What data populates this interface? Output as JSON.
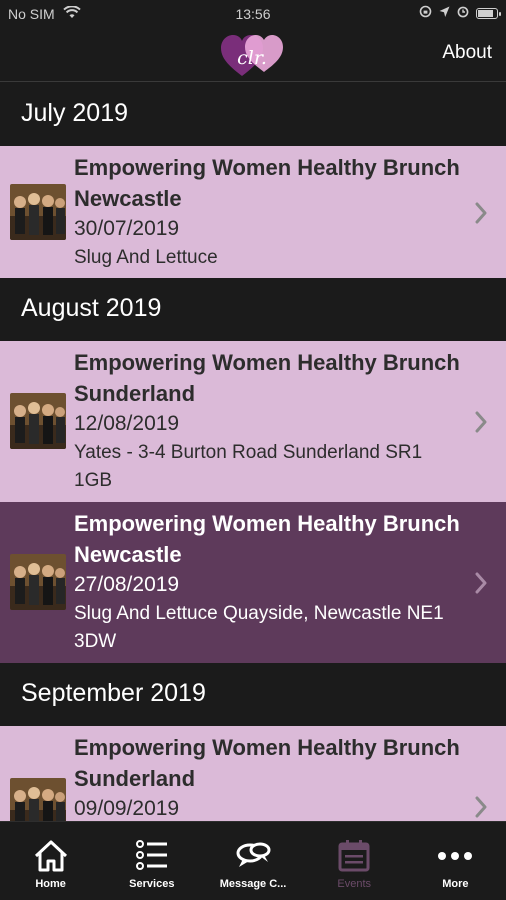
{
  "status": {
    "carrier": "No SIM",
    "time": "13:56"
  },
  "navbar": {
    "logo_text": "clr.",
    "about_label": "About"
  },
  "sections": [
    {
      "title": "July 2019",
      "events": [
        {
          "title_line1": "Empowering Women Healthy Brunch",
          "title_line2": "Newcastle",
          "date": "30/07/2019",
          "venue_line1": "Slug And Lettuce",
          "venue_line2": "",
          "selected": false
        }
      ]
    },
    {
      "title": "August 2019",
      "events": [
        {
          "title_line1": "Empowering Women Healthy Brunch",
          "title_line2": "Sunderland",
          "date": "12/08/2019",
          "venue_line1": "Yates - 3-4 Burton Road Sunderland SR1",
          "venue_line2": "1GB",
          "selected": false
        },
        {
          "title_line1": "Empowering Women Healthy Brunch",
          "title_line2": "Newcastle",
          "date": "27/08/2019",
          "venue_line1": "Slug And Lettuce Quayside, Newcastle NE1",
          "venue_line2": "3DW",
          "selected": true
        }
      ]
    },
    {
      "title": "September 2019",
      "events": [
        {
          "title_line1": "Empowering Women Healthy Brunch",
          "title_line2": "Sunderland",
          "date": "09/09/2019",
          "venue_line1": "",
          "venue_line2": "",
          "selected": false
        }
      ]
    }
  ],
  "tabs": [
    {
      "label": "Home",
      "icon": "home-icon",
      "active": false
    },
    {
      "label": "Services",
      "icon": "list-icon",
      "active": false
    },
    {
      "label": "Message C...",
      "icon": "chat-bubbles-icon",
      "active": false
    },
    {
      "label": "Events",
      "icon": "calendar-icon",
      "active": true
    },
    {
      "label": "More",
      "icon": "more-dots-icon",
      "active": false
    }
  ],
  "colors": {
    "background": "#1b1b1b",
    "row_light": "#dbbad8",
    "row_selected": "#5e3a5b",
    "tab_active": "#6b4b69"
  }
}
